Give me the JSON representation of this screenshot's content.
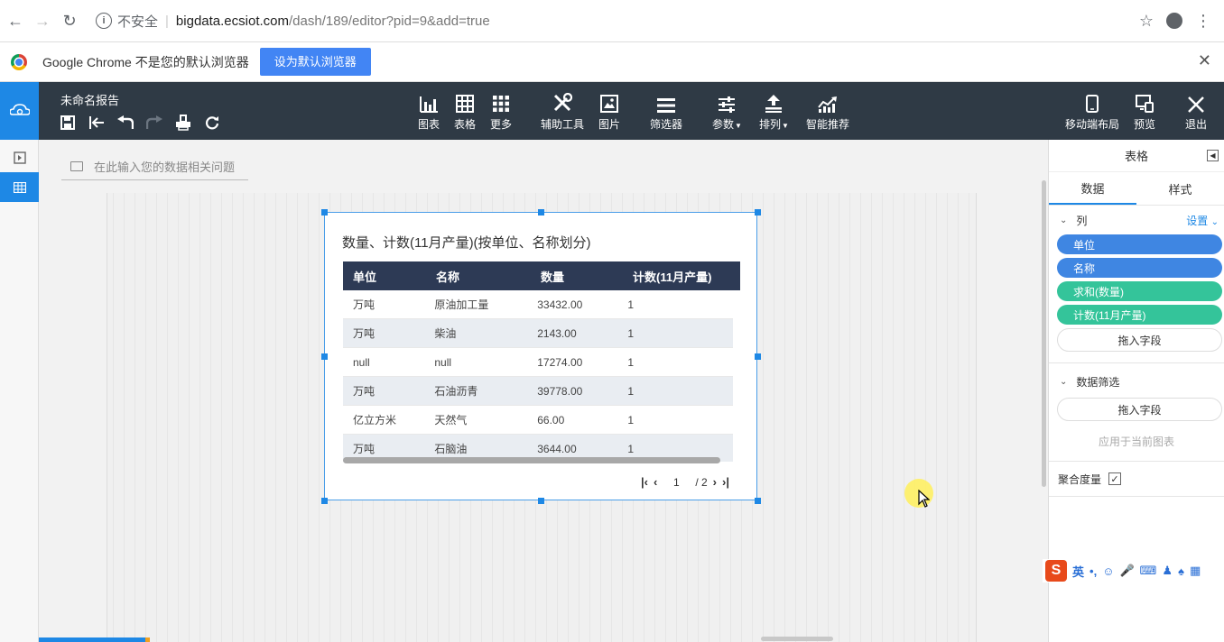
{
  "browser": {
    "security_label": "不安全",
    "url_host": "bigdata.ecsiot.com",
    "url_path": "/dash/189/editor?pid=9&add=true",
    "infobar_text": "Google Chrome 不是您的默认浏览器",
    "infobar_button": "设为默认浏览器"
  },
  "toolbar": {
    "report_title": "未命名报告",
    "tools": [
      {
        "label": "图表",
        "icon": "bar-chart-icon"
      },
      {
        "label": "表格",
        "icon": "table-icon"
      },
      {
        "label": "更多",
        "icon": "grid-icon"
      },
      {
        "label": "辅助工具",
        "icon": "tools-icon"
      },
      {
        "label": "图片",
        "icon": "image-icon"
      },
      {
        "label": "筛选器",
        "icon": "filter-icon"
      },
      {
        "label": "参数",
        "icon": "params-icon"
      },
      {
        "label": "排列",
        "icon": "arrange-icon"
      },
      {
        "label": "智能推荐",
        "icon": "smart-icon"
      },
      {
        "label": "移动端布局",
        "icon": "mobile-icon"
      },
      {
        "label": "预览",
        "icon": "preview-icon"
      },
      {
        "label": "退出",
        "icon": "close-icon"
      }
    ]
  },
  "canvas": {
    "question_placeholder": "在此输入您的数据相关问题"
  },
  "widget": {
    "title": "数量、计数(11月产量)(按单位、名称划分)",
    "columns": [
      "单位",
      "名称",
      "数量",
      "计数(11月产量)"
    ],
    "rows": [
      [
        "万吨",
        "原油加工量",
        "33432.00",
        "1"
      ],
      [
        "万吨",
        "柴油",
        "2143.00",
        "1"
      ],
      [
        "null",
        "null",
        "17274.00",
        "1"
      ],
      [
        "万吨",
        "石油沥青",
        "39778.00",
        "1"
      ],
      [
        "亿立方米",
        "天然气",
        "66.00",
        "1"
      ],
      [
        "万吨",
        "石脑油",
        "3644.00",
        "1"
      ]
    ],
    "pager": {
      "current": "1",
      "total": "/ 2"
    }
  },
  "panel": {
    "title": "表格",
    "tabs": [
      "数据",
      "样式"
    ],
    "columns_section": "列",
    "settings_link": "设置",
    "dimension_fields": [
      "单位",
      "名称"
    ],
    "measure_fields": [
      "求和(数量)",
      "计数(11月产量)"
    ],
    "drop_field": "拖入字段",
    "filter_section": "数据筛选",
    "filter_drop": "拖入字段",
    "filter_hint": "应用于当前图表",
    "aggregate_label": "聚合度量",
    "aggregate_checked": true
  },
  "ime": {
    "mode": "英"
  }
}
